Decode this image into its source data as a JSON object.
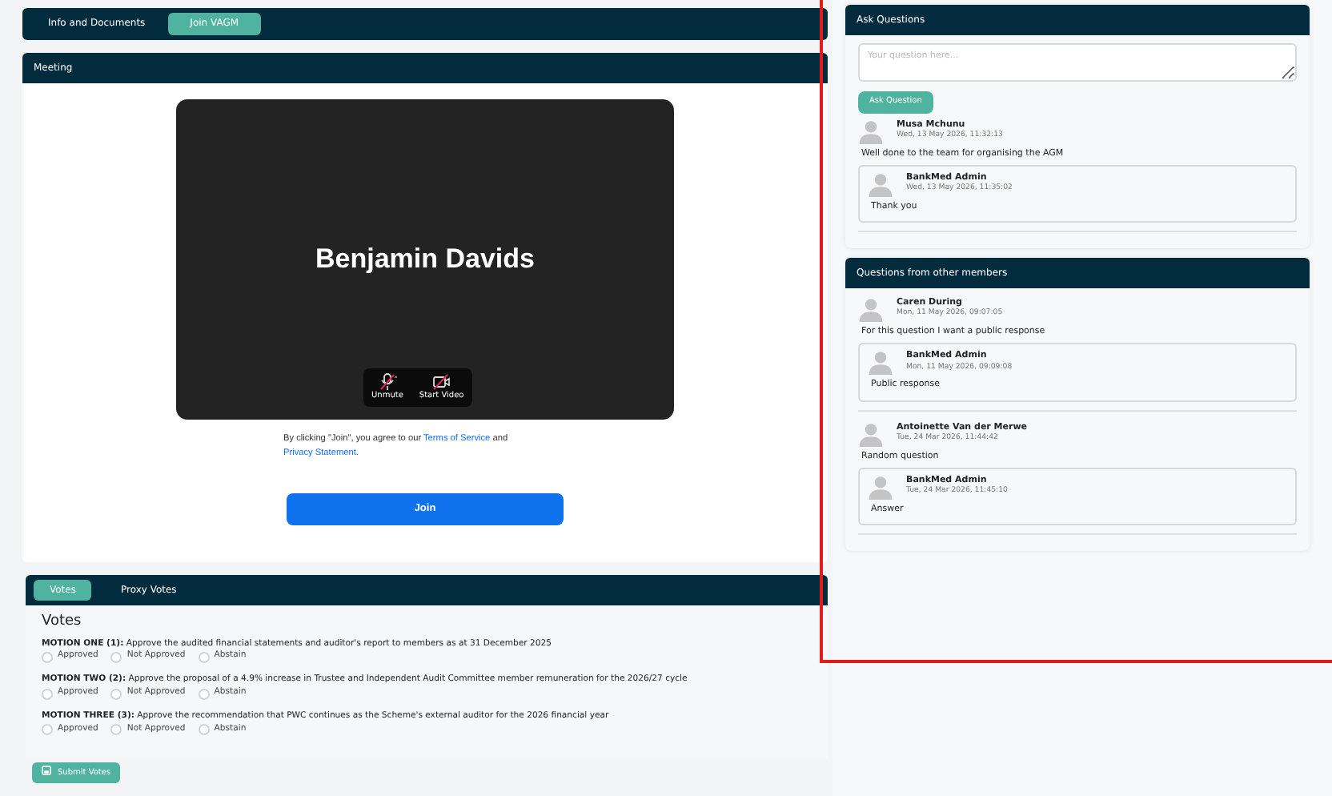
{
  "nav_tabs": [
    {
      "label": "Info and Documents",
      "selected": false
    },
    {
      "label": "Join VAGM",
      "selected": true
    }
  ],
  "meeting": {
    "title": "Meeting",
    "participant_name": "Benjamin Davids",
    "controls": [
      {
        "kind": "mic",
        "label": "Unmute"
      },
      {
        "kind": "camera",
        "label": "Start Video"
      }
    ],
    "consent": [
      {
        "kind": "text",
        "text": "By clicking \"Join\", you agree to our "
      },
      {
        "kind": "link",
        "text": "Terms of Service"
      },
      {
        "kind": "text",
        "text": " and "
      },
      {
        "kind": "link",
        "text": "Privacy Statement"
      },
      {
        "kind": "text",
        "text": "."
      }
    ],
    "join_button": "Join"
  },
  "votes": {
    "tabs": [
      {
        "label": "Votes",
        "selected": true
      },
      {
        "label": "Proxy Votes",
        "selected": false
      }
    ],
    "heading": "Votes",
    "motions": [
      {
        "label": "MOTION ONE (1):",
        "text": "Approve the audited financial statements and auditor's report to members as at 31 December 2025",
        "options": [
          {
            "label": "Approved",
            "selected": false
          },
          {
            "label": "Not Approved",
            "selected": false
          },
          {
            "label": "Abstain",
            "selected": false
          }
        ]
      },
      {
        "label": "MOTION TWO (2):",
        "text": "Approve the proposal of a 4.9% increase in Trustee and Independent Audit Committee member remuneration for the 2026/27 cycle",
        "options": [
          {
            "label": "Approved",
            "selected": false
          },
          {
            "label": "Not Approved",
            "selected": false
          },
          {
            "label": "Abstain",
            "selected": false
          }
        ]
      },
      {
        "label": "MOTION THREE (3):",
        "text": "Approve the recommendation that PWC continues as the Scheme's external auditor for the 2026 financial year",
        "options": [
          {
            "label": "Approved",
            "selected": false
          },
          {
            "label": "Not Approved",
            "selected": false
          },
          {
            "label": "Abstain",
            "selected": false
          }
        ]
      }
    ],
    "submit_button": "Submit Votes"
  },
  "ask_questions": {
    "title": "Ask Questions",
    "placeholder": "Your question here...",
    "button": "Ask Question",
    "questions": [
      {
        "author": "Musa Mchunu",
        "time": "Wed, 13 May 2026, 11:32:13",
        "text": "Well done to the team for organising the AGM",
        "replies": [
          {
            "author": "BankMed Admin",
            "time": "Wed, 13 May 2026, 11:35:02",
            "text": "Thank you"
          }
        ]
      }
    ]
  },
  "other_questions": {
    "title": "Questions from other members",
    "questions": [
      {
        "author": "Caren During",
        "time": "Mon, 11 May 2026, 09:07:05",
        "text": "For this question I want a public response",
        "replies": [
          {
            "author": "BankMed Admin",
            "time": "Mon, 11 May 2026, 09:09:08",
            "text": "Public response"
          }
        ]
      },
      {
        "author": "Antoinette Van der Merwe",
        "time": "Tue, 24 Mar 2026, 11:44:42",
        "text": "Random question",
        "replies": [
          {
            "author": "BankMed Admin",
            "time": "Tue, 24 Mar 2026, 11:45:10",
            "text": "Answer"
          }
        ]
      }
    ]
  }
}
